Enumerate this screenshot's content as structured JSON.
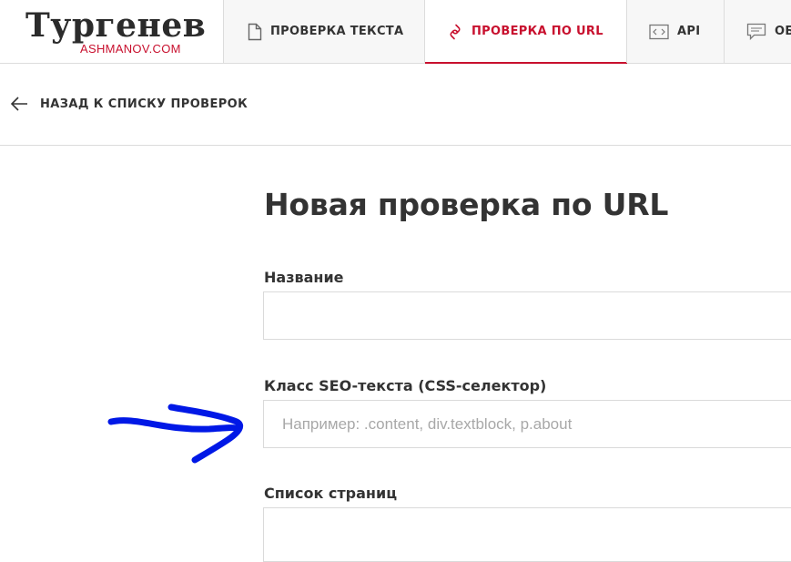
{
  "header": {
    "logo_main": "Тургенев",
    "logo_sub": "ASHMANOV.COM",
    "tabs": [
      {
        "label": "ПРОВЕРКА ТЕКСТА",
        "icon": "document-icon",
        "active": false
      },
      {
        "label": "ПРОВЕРКА ПО URL",
        "icon": "link-icon",
        "active": true
      },
      {
        "label": "API",
        "icon": "code-icon",
        "active": false
      },
      {
        "label": "ОБ",
        "icon": "comment-icon",
        "active": false
      }
    ]
  },
  "back": {
    "label": "НАЗАД К СПИСКУ ПРОВЕРОК",
    "icon": "arrow-left-icon"
  },
  "form": {
    "title": "Новая проверка по URL",
    "fields": [
      {
        "label": "Название",
        "value": "",
        "placeholder": ""
      },
      {
        "label": "Класс SEO-текста (CSS-селектор)",
        "value": "",
        "placeholder": "Например: .content, div.textblock, p.about"
      },
      {
        "label": "Список страниц",
        "value": "",
        "placeholder": ""
      }
    ]
  },
  "colors": {
    "accent": "#c8102e",
    "annotation": "#0018e6",
    "border": "#dcdcdc"
  }
}
